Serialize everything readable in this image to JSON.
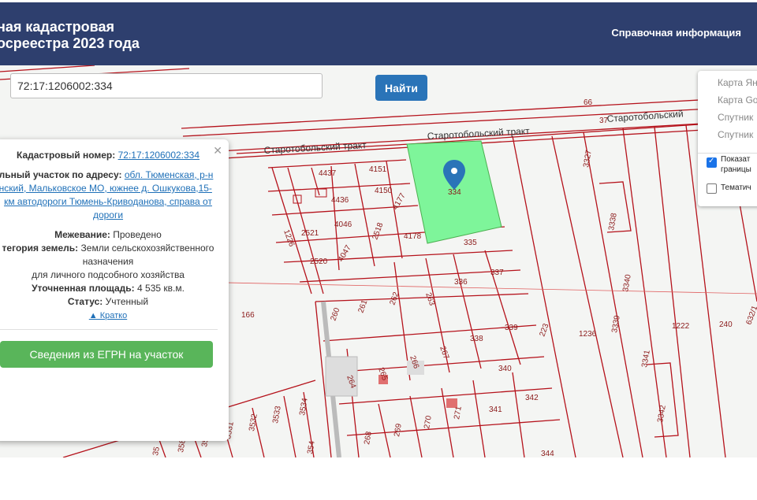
{
  "header": {
    "title_line1": "ная кадастровая",
    "title_line2": "осреестра 2023 года",
    "ref_link": "Справочная информация"
  },
  "search": {
    "value": "72:17:1206002:334",
    "button": "Найти"
  },
  "layers": {
    "items": [
      "Карта Ян",
      "Карта Go",
      "Спутник",
      "Спутник"
    ],
    "show_borders_1": "Показат",
    "show_borders_2": "границы",
    "thematic": "Тематич"
  },
  "popup": {
    "cad_label": "Кадастровый номер:",
    "cad_value": "72:17:1206002:334",
    "addr_label": "ельный участок по адресу:",
    "addr_line1": "обл. Тюменская, р-н",
    "addr_line2": "енский, Мальковское МО, южнее д. Ошкукова,15-",
    "addr_line3": "км автодороги Тюмень-Криводанова, справа от",
    "addr_line4": "дороги",
    "survey_label": "Межевание:",
    "survey_value": "Проведено",
    "cat_label": "тегория земель:",
    "cat_value": "Земли сельскохозяйственного",
    "cat_value2": "назначения",
    "use": "для личного подсобного хозяйства",
    "area_label": "Уточненная площадь:",
    "area_value": "4 535 кв.м.",
    "status_label": "Статус:",
    "status_value": "Учтенный",
    "short": "▲ Кратко",
    "egrn_button": "Сведения из ЕГРН на участок"
  },
  "map": {
    "roads": [
      "Старотобольский тракт",
      "Старотобольский тракт",
      "Старотобольский"
    ],
    "highlight": "334",
    "parcels": [
      "66",
      "37",
      "4437",
      "4151",
      "4436",
      "4150",
      "4177",
      "4178",
      "2521",
      "4046",
      "2518",
      "2520",
      "4047",
      "1226",
      "335",
      "336",
      "337",
      "263",
      "262",
      "261",
      "260",
      "166",
      "339",
      "338",
      "267",
      "266",
      "265",
      "264",
      "223",
      "1236",
      "1222",
      "240",
      "632/1",
      "3327",
      "3338",
      "3340",
      "3339",
      "3341",
      "3342",
      "340",
      "341",
      "342",
      "271",
      "270",
      "269",
      "268",
      "3534",
      "3533",
      "3532",
      "3531",
      "3530",
      "358",
      "35",
      "354",
      "344"
    ]
  },
  "colors": {
    "header": "#2e3f6e",
    "button": "#2a74b8",
    "egrn": "#59b55a",
    "parcel_line": "#b5121b",
    "highlight": "#7ef59a"
  }
}
